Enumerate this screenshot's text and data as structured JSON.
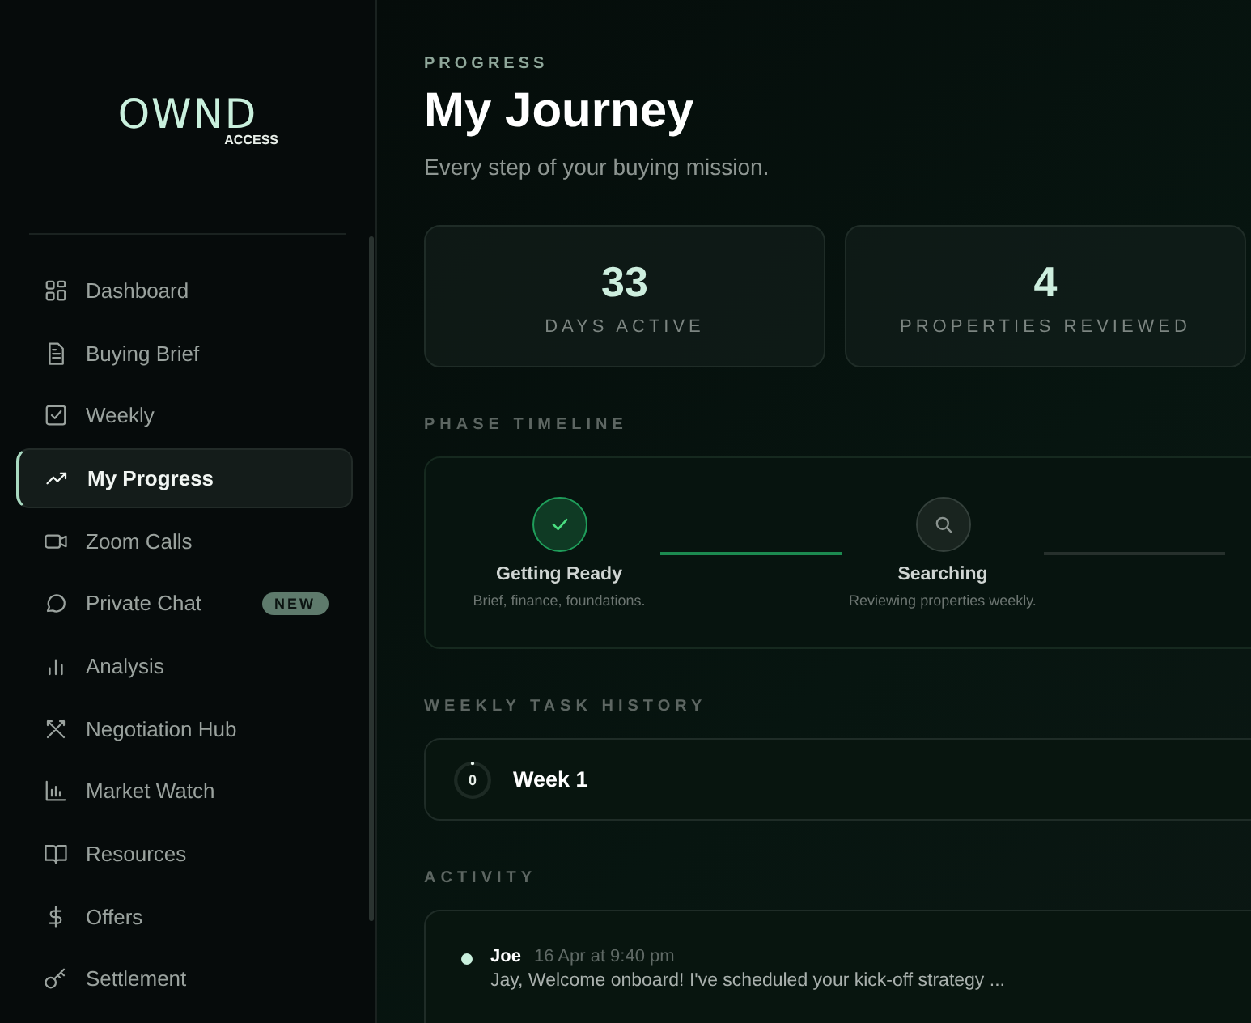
{
  "brand": {
    "name": "OWND",
    "tagline": "ACCESS"
  },
  "sidebar": {
    "items": [
      {
        "label": "Dashboard",
        "selected": false
      },
      {
        "label": "Buying Brief",
        "selected": false
      },
      {
        "label": "Weekly",
        "selected": false
      },
      {
        "label": "My Progress",
        "selected": true
      },
      {
        "label": "Zoom Calls",
        "selected": false
      },
      {
        "label": "Private Chat",
        "selected": false,
        "badge": "NEW"
      },
      {
        "label": "Analysis",
        "selected": false
      },
      {
        "label": "Negotiation Hub",
        "selected": false
      },
      {
        "label": "Market Watch",
        "selected": false
      },
      {
        "label": "Resources",
        "selected": false
      },
      {
        "label": "Offers",
        "selected": false
      },
      {
        "label": "Settlement",
        "selected": false
      }
    ]
  },
  "header": {
    "eyebrow": "PROGRESS",
    "title": "My Journey",
    "subtitle": "Every step of your buying mission."
  },
  "stats": [
    {
      "value": "33",
      "label": "DAYS ACTIVE"
    },
    {
      "value": "4",
      "label": "PROPERTIES REVIEWED"
    }
  ],
  "phase_timeline": {
    "heading": "PHASE TIMELINE",
    "phases": [
      {
        "title": "Getting Ready",
        "description": "Brief, finance, foundations.",
        "completed": true
      },
      {
        "title": "Searching",
        "description": "Reviewing properties weekly.",
        "completed": false
      }
    ]
  },
  "weekly_task_history": {
    "heading": "WEEKLY TASK HISTORY",
    "weeks": [
      {
        "title": "Week 1",
        "count": "0",
        "level": 0
      }
    ]
  },
  "activity": {
    "heading": "ACTIVITY",
    "entries": [
      {
        "author": "Joe",
        "time": "16 Apr at 9:40 pm",
        "message": "Jay, Welcome onboard! I've scheduled your kick-off strategy ..."
      }
    ]
  }
}
